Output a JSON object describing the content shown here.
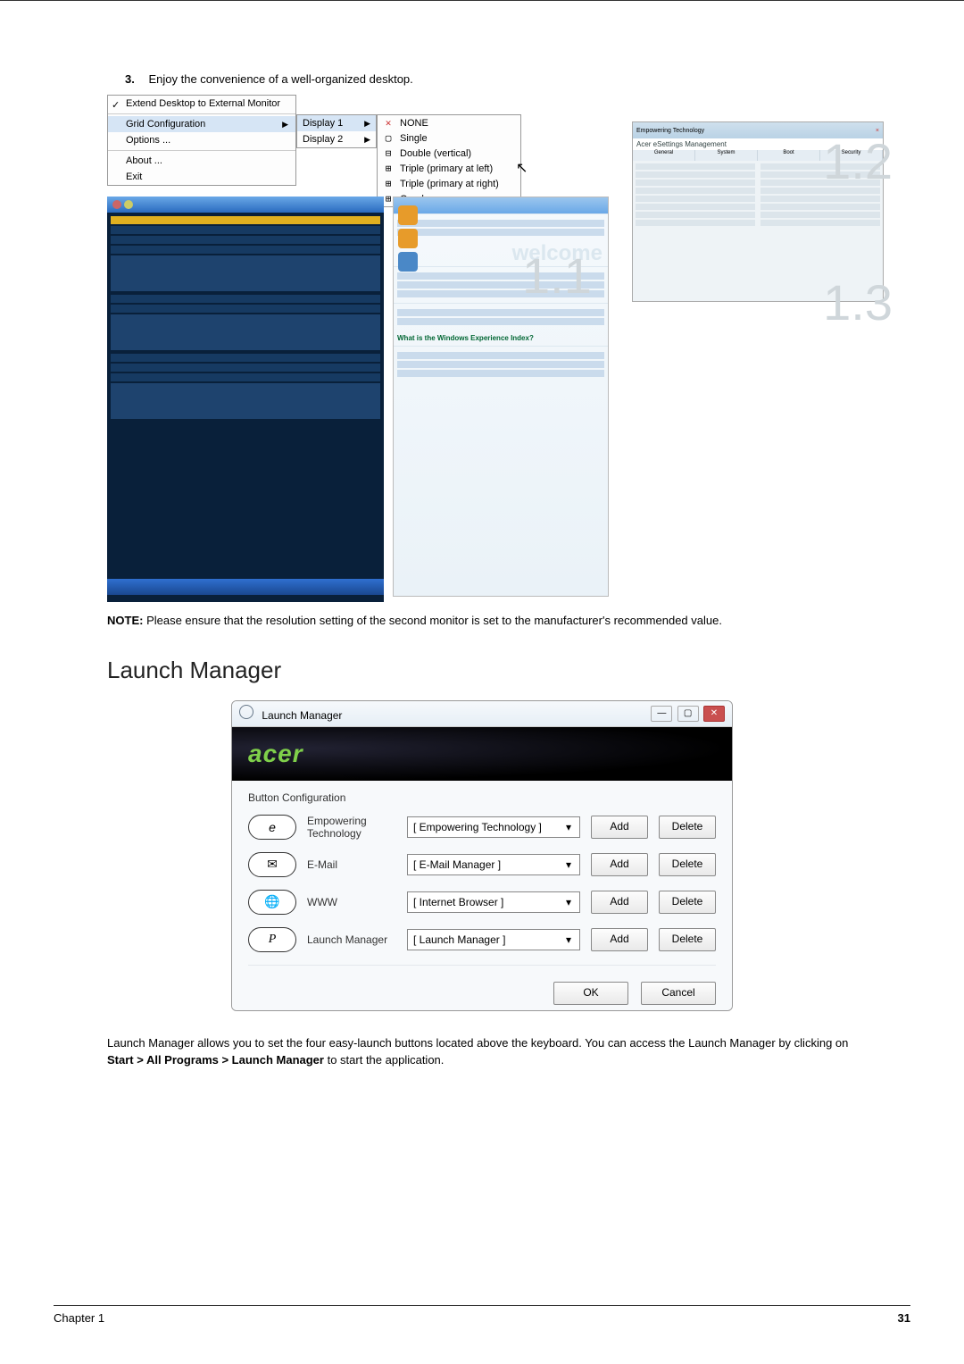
{
  "step": {
    "num": "3.",
    "text": "Enjoy the convenience of a well-organized desktop."
  },
  "ctx": {
    "extend": "Extend Desktop to External Monitor",
    "grid": "Grid Configuration",
    "options": "Options ...",
    "about": "About ...",
    "exit": "Exit"
  },
  "flyout2": {
    "d1": "Display 1",
    "d2": "Display 2"
  },
  "flyout3": {
    "none": "NONE",
    "single": "Single",
    "double": "Double (vertical)",
    "tl": "Triple (primary at left)",
    "tr": "Triple (primary at right)",
    "quad": "Quad"
  },
  "overlay": {
    "n11": "1.1",
    "n12": "1.2",
    "n13": "1.3"
  },
  "eset": {
    "title": "Acer eSettings Management",
    "tabs": {
      "a": "General",
      "b": "System",
      "c": "Boot",
      "d": "Security"
    }
  },
  "rp": {
    "welcome": "welcome",
    "q": "What is the Windows Experience Index?"
  },
  "note": {
    "label": "NOTE:",
    "text": " Please ensure that the resolution setting of the second monitor is set to the manufacturer's recommended value."
  },
  "launch": {
    "heading": "Launch Manager",
    "title": "Launch Manager",
    "brand": "acer",
    "section": "Button Configuration",
    "rows": {
      "emp": {
        "name": "Empowering Technology",
        "sel": "[ Empowering Technology ]"
      },
      "mail": {
        "name": "E-Mail",
        "sel": "[ E-Mail Manager ]"
      },
      "www": {
        "name": "WWW",
        "sel": "[ Internet Browser ]"
      },
      "lm": {
        "name": "Launch Manager",
        "sel": "[ Launch Manager ]"
      }
    },
    "add": "Add",
    "del": "Delete",
    "ok": "OK",
    "cancel": "Cancel",
    "key_e": "e",
    "key_m": "✉",
    "key_w": "🌐",
    "key_p": "P"
  },
  "para1": "Launch Manager allows you to set the four easy-launch buttons located above the keyboard. You can access the Launch Manager by clicking on ",
  "para_bold": "Start > All Programs > Launch Manager",
  "para2": " to start the application.",
  "footer": {
    "chapter": "Chapter 1",
    "page": "31"
  }
}
